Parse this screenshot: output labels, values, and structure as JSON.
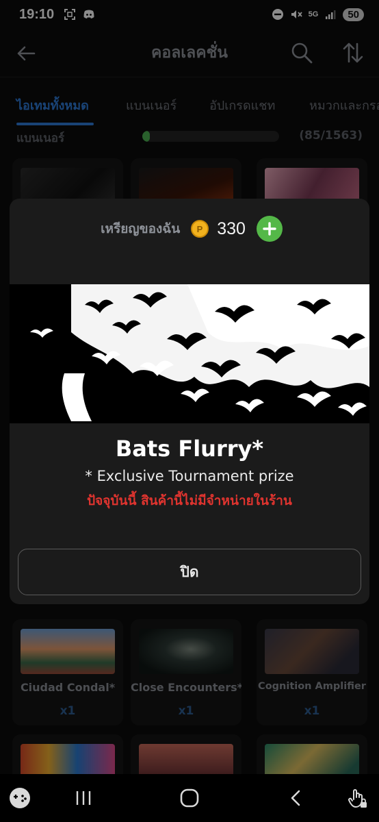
{
  "status_bar": {
    "time": "19:10",
    "battery": "50",
    "network": "5G"
  },
  "app_bar": {
    "title": "คอลเลคชั่น"
  },
  "tabs": [
    {
      "label": "ไอเทมทั้งหมด",
      "active": true
    },
    {
      "label": "แบนเนอร์",
      "active": false
    },
    {
      "label": "อัปเกรดแชท",
      "active": false
    },
    {
      "label": "หมวกและกรอบ",
      "active": false
    }
  ],
  "section": {
    "label": "แบนเนอร์",
    "count_text": "(85/1563)",
    "collected": 85,
    "total": 1563
  },
  "grid_row2": [
    {
      "name": "Ciudad Condal*",
      "qty": "x1"
    },
    {
      "name": "Close Encounters*",
      "qty": "x1"
    },
    {
      "name": "Cognition Amplifier",
      "qty": "x1"
    }
  ],
  "modal": {
    "coins_label": "เหรียญของฉัน",
    "coin_symbol": "P",
    "coins_value": "330",
    "item_name": "Bats Flurry*",
    "note": "* Exclusive Tournament prize",
    "warning": "ปัจจุบันนี้ สินค้านี้ไม่มีจำหน่ายในร้าน",
    "close_label": "ปิด"
  },
  "colors": {
    "accent_blue": "#2f7bd8",
    "warning_red": "#e0342f",
    "add_green": "#54b848",
    "coin_gold": "#f1b11e"
  }
}
